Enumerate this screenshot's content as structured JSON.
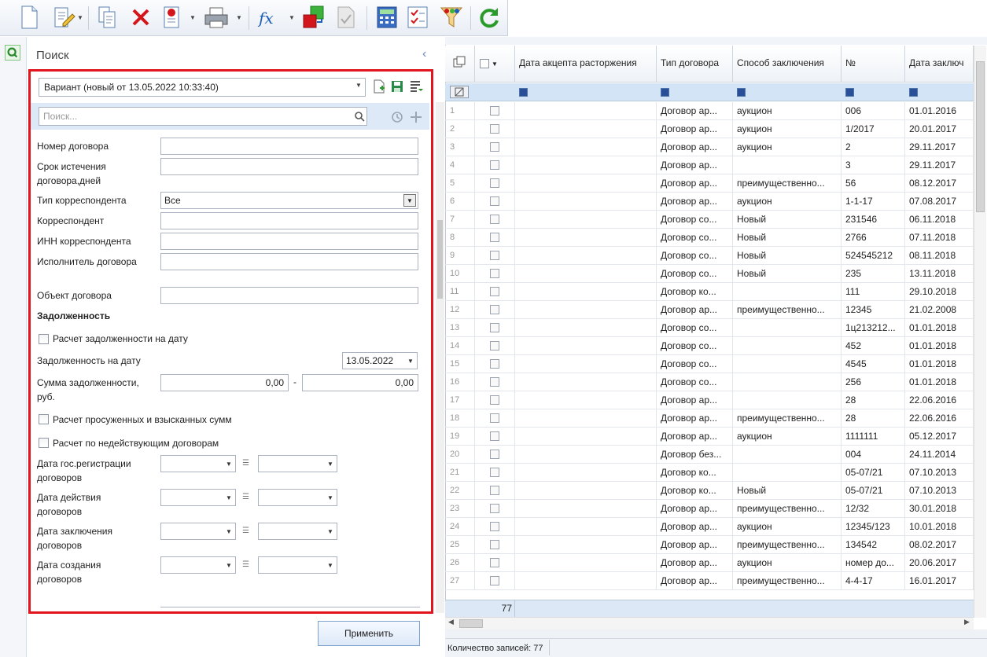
{
  "toolbar": {
    "icons": [
      "new-document-icon",
      "edit-icon",
      "copy-icon",
      "delete-icon",
      "certificate-icon",
      "print-icon",
      "formula-icon",
      "transfer-icon",
      "check-document-icon",
      "calculator-icon",
      "checklist-icon",
      "filter-icon",
      "refresh-icon"
    ]
  },
  "search_panel": {
    "title": "Поиск",
    "variant": "Вариант (новый от 13.05.2022 10:33:40)",
    "search_placeholder": "Поиск...",
    "labels": {
      "contract_number": "Номер договора",
      "expiry_days": "Срок истечения договора,дней",
      "correspondent_type": "Тип корреспондента",
      "correspondent": "Корреспондент",
      "correspondent_inn": "ИНН корреспондента",
      "executor": "Исполнитель договора",
      "object": "Объект договора",
      "debt_section": "Задолженность",
      "calc_debt_date": "Расчет задолженности на дату",
      "debt_on_date": "Задолженность на дату",
      "debt_sum": "Сумма задолженности, руб.",
      "calc_overdue": "Расчет просуженных и взысканных сумм",
      "calc_inactive": "Расчет по недействующим договорам",
      "date_registration": "Дата гос.регистрации договоров",
      "date_action": "Дата действия договоров",
      "date_conclusion": "Дата заключения договоров",
      "date_creation": "Дата создания договоров"
    },
    "values": {
      "correspondent_type": "Все",
      "debt_date": "13.05.2022",
      "debt_from": "0,00",
      "debt_to": "0,00",
      "range_dash": "-"
    },
    "apply_button": "Применить"
  },
  "grid": {
    "columns": [
      "Дата акцепта расторжения",
      "Тип договора",
      "Способ заключения",
      "№",
      "Дата заключ"
    ],
    "rows": [
      [
        "1",
        "",
        "Договор ар...",
        "аукцион",
        "006",
        "01.01.2016"
      ],
      [
        "2",
        "",
        "Договор ар...",
        "аукцион",
        "1/2017",
        "20.01.2017"
      ],
      [
        "3",
        "",
        "Договор ар...",
        "аукцион",
        "2",
        "29.11.2017"
      ],
      [
        "4",
        "",
        "Договор ар...",
        "",
        "3",
        "29.11.2017"
      ],
      [
        "5",
        "",
        "Договор ар...",
        "преимущественно...",
        "56",
        "08.12.2017"
      ],
      [
        "6",
        "",
        "Договор ар...",
        "аукцион",
        "1-1-17",
        "07.08.2017"
      ],
      [
        "7",
        "",
        "Договор со...",
        "Новый",
        "231546",
        "06.11.2018"
      ],
      [
        "8",
        "",
        "Договор со...",
        "Новый",
        "2766",
        "07.11.2018"
      ],
      [
        "9",
        "",
        "Договор со...",
        "Новый",
        "524545212",
        "08.11.2018"
      ],
      [
        "10",
        "",
        "Договор со...",
        "Новый",
        "235",
        "13.11.2018"
      ],
      [
        "11",
        "",
        "Договор ко...",
        "",
        "111",
        "29.10.2018"
      ],
      [
        "12",
        "",
        "Договор ар...",
        "преимущественно...",
        "12345",
        "21.02.2008"
      ],
      [
        "13",
        "",
        "Договор со...",
        "",
        "1ц213212...",
        "01.01.2018"
      ],
      [
        "14",
        "",
        "Договор со...",
        "",
        "452",
        "01.01.2018"
      ],
      [
        "15",
        "",
        "Договор со...",
        "",
        "4545",
        "01.01.2018"
      ],
      [
        "16",
        "",
        "Договор со...",
        "",
        "256",
        "01.01.2018"
      ],
      [
        "17",
        "",
        "Договор ар...",
        "",
        "28",
        "22.06.2016"
      ],
      [
        "18",
        "",
        "Договор ар...",
        "преимущественно...",
        "28",
        "22.06.2016"
      ],
      [
        "19",
        "",
        "Договор ар...",
        "аукцион",
        "1111111",
        "05.12.2017"
      ],
      [
        "20",
        "",
        "Договор без...",
        "",
        "004",
        "24.11.2014"
      ],
      [
        "21",
        "",
        "Договор ко...",
        "",
        "05-07/21",
        "07.10.2013"
      ],
      [
        "22",
        "",
        "Договор ко...",
        "Новый",
        "05-07/21",
        "07.10.2013"
      ],
      [
        "23",
        "",
        "Договор ар...",
        "преимущественно...",
        "12/32",
        "30.01.2018"
      ],
      [
        "24",
        "",
        "Договор ар...",
        "аукцион",
        "12345/123",
        "10.01.2018"
      ],
      [
        "25",
        "",
        "Договор ар...",
        "преимущественно...",
        "134542",
        "08.02.2017"
      ],
      [
        "26",
        "",
        "Договор ар...",
        "аукцион",
        "номер до...",
        "20.06.2017"
      ],
      [
        "27",
        "",
        "Договор ар...",
        "преимущественно...",
        "4-4-17",
        "16.01.2017"
      ]
    ],
    "footer_count": "77",
    "status": "Количество записей: 77"
  },
  "colors": {
    "highlight": "#e0151d",
    "accent": "#2a4f99"
  }
}
